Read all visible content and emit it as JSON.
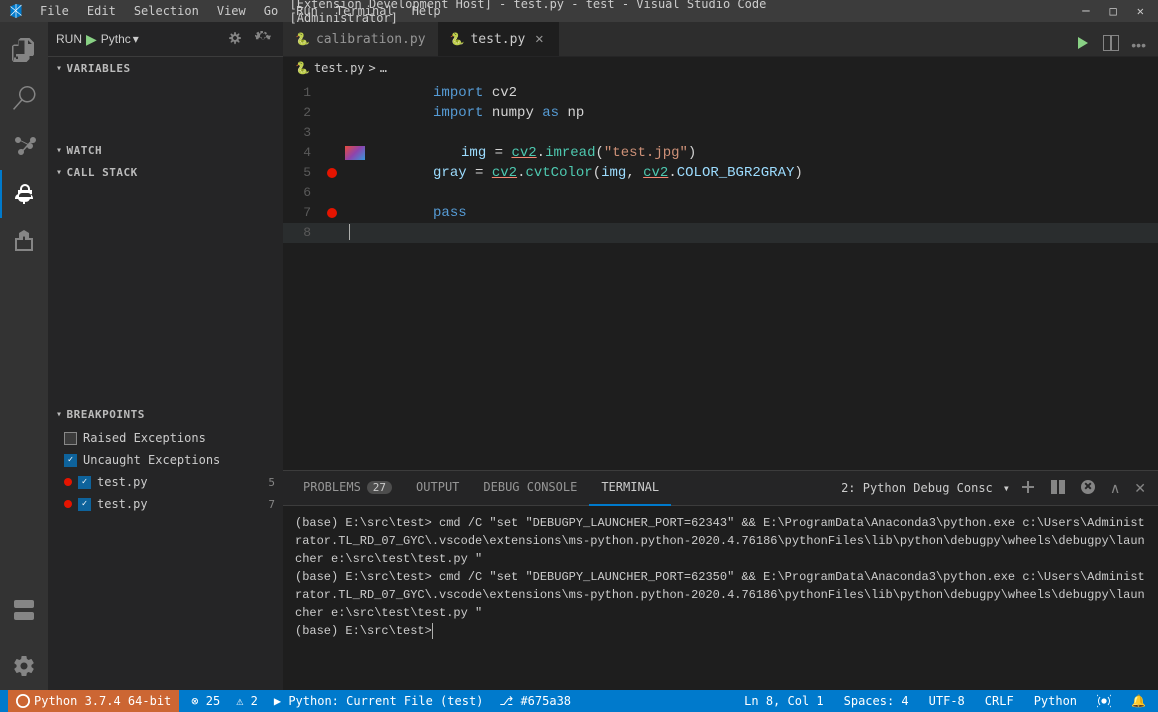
{
  "titlebar": {
    "title": "[Extension Development Host] - test.py - test - Visual Studio Code [Administrator]",
    "menus": [
      "File",
      "Edit",
      "Selection",
      "View",
      "Go",
      "Run",
      "Terminal",
      "Help"
    ],
    "controls": [
      "─",
      "□",
      "✕"
    ]
  },
  "debug_toolbar": {
    "run_label": "RUN",
    "python_label": "Pythc",
    "settings_icon": "⚙",
    "restart_icon": "↻"
  },
  "tabs": [
    {
      "label": "calibration.py",
      "icon": "🐍",
      "active": false,
      "dirty": false
    },
    {
      "label": "test.py",
      "icon": "🐍",
      "active": true,
      "dirty": false
    }
  ],
  "breadcrumb": {
    "file": "test.py",
    "separator": ">",
    "path": "…"
  },
  "code_lines": [
    {
      "num": "1",
      "content": "import cv2",
      "has_breakpoint": false,
      "has_img": false
    },
    {
      "num": "2",
      "content": "import numpy as np",
      "has_breakpoint": false,
      "has_img": false
    },
    {
      "num": "3",
      "content": "",
      "has_breakpoint": false,
      "has_img": false
    },
    {
      "num": "4",
      "content": "img = cv2.imread(\"test.jpg\")",
      "has_breakpoint": false,
      "has_img": true
    },
    {
      "num": "5",
      "content": "gray = cv2.cvtColor(img, cv2.COLOR_BGR2GRAY)",
      "has_breakpoint": true,
      "has_img": false
    },
    {
      "num": "6",
      "content": "",
      "has_breakpoint": false,
      "has_img": false
    },
    {
      "num": "7",
      "content": "pass",
      "has_breakpoint": true,
      "has_img": false
    },
    {
      "num": "8",
      "content": "",
      "has_breakpoint": false,
      "has_img": false,
      "cursor": true
    }
  ],
  "sidebar": {
    "variables_label": "VARIABLES",
    "watch_label": "WATCH",
    "call_stack_label": "CALL STACK",
    "breakpoints_label": "BREAKPOINTS"
  },
  "breakpoints": [
    {
      "type": "checkbox",
      "checked": false,
      "label": "Raised Exceptions"
    },
    {
      "type": "checkbox",
      "checked": true,
      "label": "Uncaught Exceptions"
    },
    {
      "type": "file",
      "has_dot": true,
      "filename": "test.py",
      "line": "5"
    },
    {
      "type": "file",
      "has_dot": true,
      "filename": "test.py",
      "line": "7"
    }
  ],
  "panel": {
    "tabs": [
      "PROBLEMS",
      "OUTPUT",
      "DEBUG CONSOLE",
      "TERMINAL"
    ],
    "active_tab": "TERMINAL",
    "problems_count": "27",
    "terminal_title": "2: Python Debug Consc",
    "terminal_lines": [
      "(base) E:\\src\\test> cmd /C \"set \"DEBUGPY_LAUNCHER_PORT=62343\" && E:\\ProgramData\\Anaconda3\\python.exe c:\\Users\\Administrator.TL_RD_07_GYC\\.vscode\\extensions\\ms-python.python-2020.4.76186\\pythonFiles\\lib\\python\\debugpy\\wheels\\debugpy\\launcher e:\\src\\test\\test.py \"",
      "(base) E:\\src\\test> cmd /C \"set \"DEBUGPY_LAUNCHER_PORT=62350\" && E:\\ProgramData\\Anaconda3\\python.exe c:\\Users\\Administrator.TL_RD_07_GYC\\.vscode\\extensions\\ms-python.python-2020.4.76186\\pythonFiles\\lib\\python\\debugpy\\wheels\\debugpy\\launcher e:\\src\\test\\test.py \"",
      "(base) E:\\src\\test>"
    ]
  },
  "status_bar": {
    "python_version": "Python 3.7.4 64-bit",
    "errors": "⊗ 25",
    "warnings": "⚠ 2",
    "debug_label": "▶ Python: Current File (test)",
    "git_branch": "⎇ #675a38",
    "line_col": "Ln 8, Col 1",
    "spaces": "Spaces: 4",
    "encoding": "UTF-8",
    "line_ending": "CRLF",
    "language": "Python",
    "bell_icon": "🔔"
  }
}
